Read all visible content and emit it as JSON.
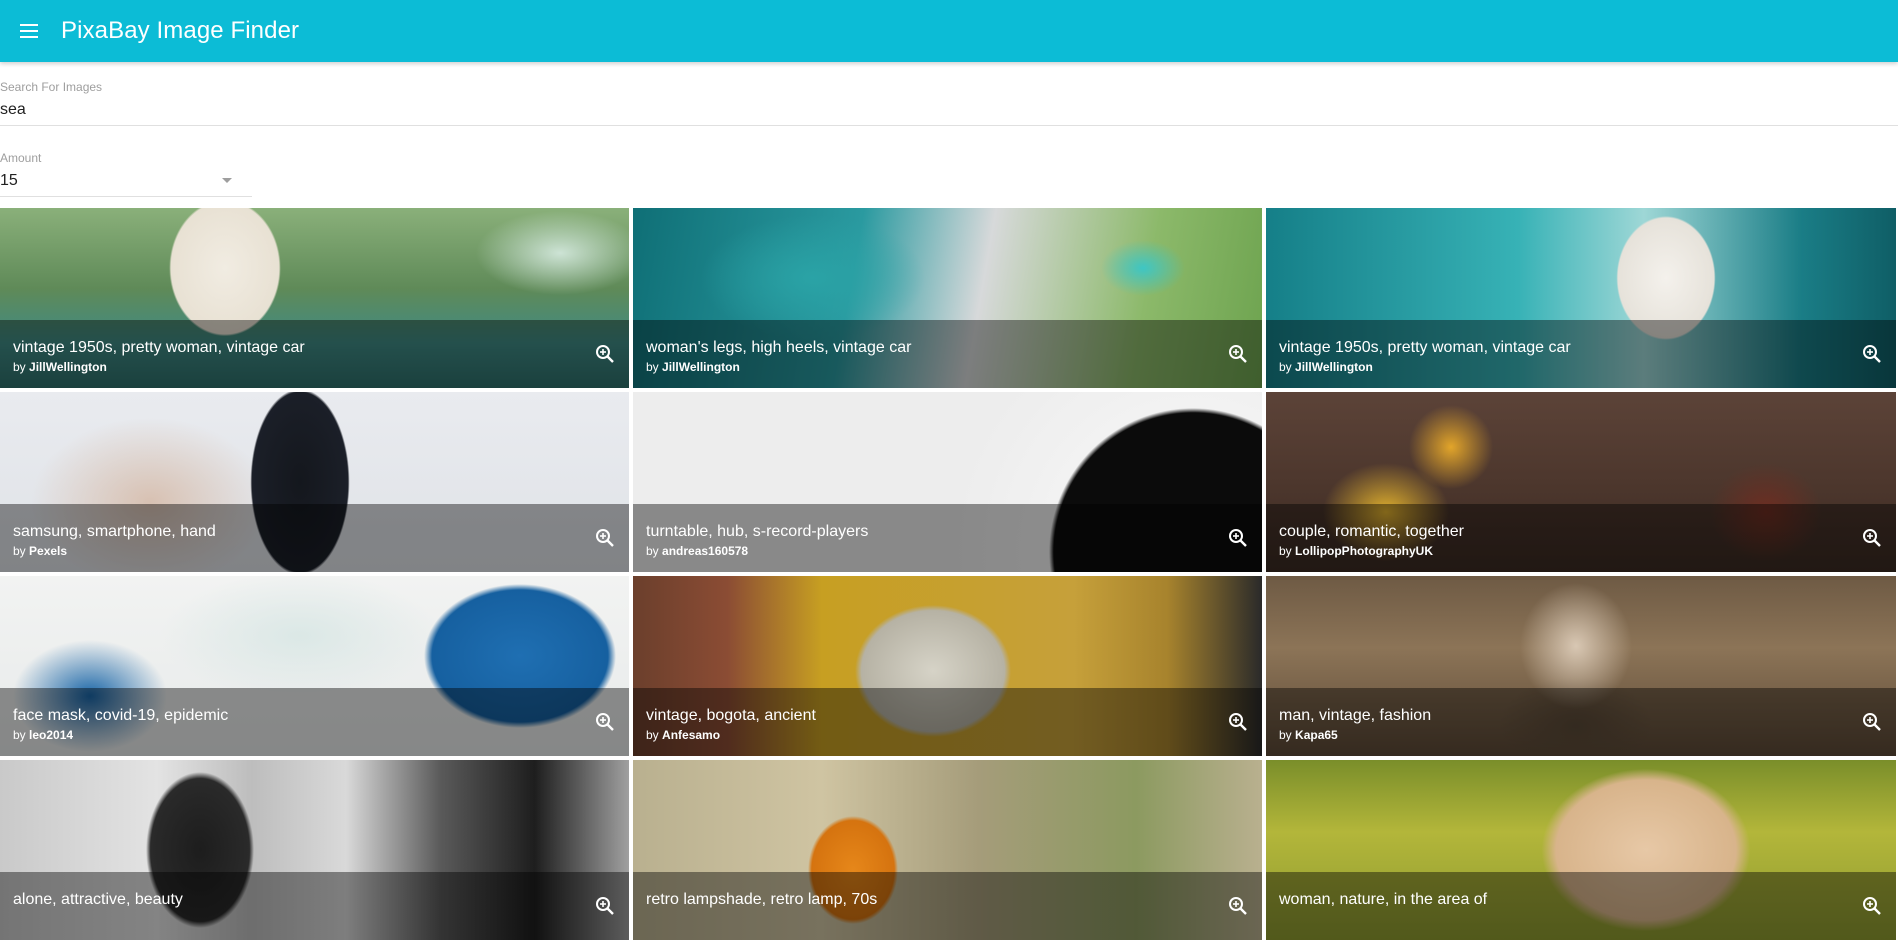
{
  "app": {
    "title": "PixaBay Image Finder",
    "bar_color": "#0cbcd6",
    "menu_icon": "menu-icon"
  },
  "search": {
    "label": "Search For Images",
    "value": "sea"
  },
  "amount": {
    "label": "Amount",
    "value": "15"
  },
  "results": [
    {
      "title": "vintage 1950s, pretty woman, vintage car",
      "by": "by",
      "author": "JillWellington"
    },
    {
      "title": "woman's legs, high heels, vintage car",
      "by": "by",
      "author": "JillWellington"
    },
    {
      "title": "vintage 1950s, pretty woman, vintage car",
      "by": "by",
      "author": "JillWellington"
    },
    {
      "title": "samsung, smartphone, hand",
      "by": "by",
      "author": "Pexels"
    },
    {
      "title": "turntable, hub, s-record-players",
      "by": "by",
      "author": "andreas160578"
    },
    {
      "title": "couple, romantic, together",
      "by": "by",
      "author": "LollipopPhotographyUK"
    },
    {
      "title": "face mask, covid-19, epidemic",
      "by": "by",
      "author": "leo2014"
    },
    {
      "title": "vintage, bogota, ancient",
      "by": "by",
      "author": "Anfesamo"
    },
    {
      "title": "man, vintage, fashion",
      "by": "by",
      "author": "Kapa65"
    },
    {
      "title": "alone, attractive, beauty",
      "by": "",
      "author": ""
    },
    {
      "title": "retro lampshade, retro lamp, 70s",
      "by": "",
      "author": ""
    },
    {
      "title": "woman, nature, in the area of",
      "by": "",
      "author": ""
    }
  ]
}
